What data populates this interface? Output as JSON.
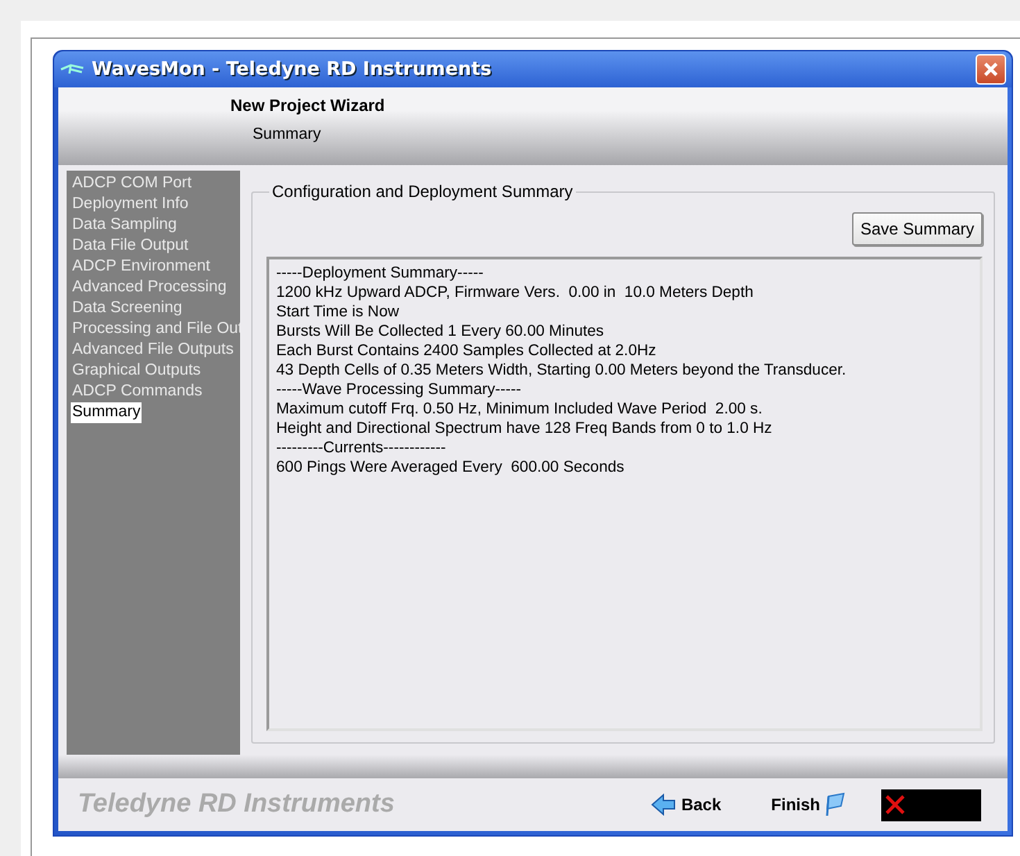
{
  "window": {
    "title": "WavesMon - Teledyne RD Instruments"
  },
  "header": {
    "title": "New Project Wizard",
    "subtitle": "Summary"
  },
  "sidebar": {
    "items": [
      {
        "label": "ADCP COM Port",
        "selected": false
      },
      {
        "label": "Deployment Info",
        "selected": false
      },
      {
        "label": "Data Sampling",
        "selected": false
      },
      {
        "label": "Data File Output",
        "selected": false
      },
      {
        "label": "ADCP Environment",
        "selected": false
      },
      {
        "label": "Advanced Processing",
        "selected": false
      },
      {
        "label": "Data Screening",
        "selected": false
      },
      {
        "label": "Processing and File Out",
        "selected": false
      },
      {
        "label": "Advanced File Outputs",
        "selected": false
      },
      {
        "label": "Graphical Outputs",
        "selected": false
      },
      {
        "label": "ADCP Commands",
        "selected": false
      },
      {
        "label": "Summary",
        "selected": true
      }
    ]
  },
  "group": {
    "title": "Configuration and Deployment Summary",
    "save_button": "Save Summary",
    "lines": [
      "-----Deployment Summary-----",
      "1200 kHz Upward ADCP, Firmware Vers.  0.00 in  10.0 Meters Depth",
      "Start Time is Now",
      "Bursts Will Be Collected 1 Every 60.00 Minutes",
      "Each Burst Contains 2400 Samples Collected at 2.0Hz",
      "43 Depth Cells of 0.35 Meters Width, Starting 0.00 Meters beyond the Transducer.",
      "-----Wave Processing Summary-----",
      "Maximum cutoff Frq. 0.50 Hz, Minimum Included Wave Period  2.00 s.",
      "Height and Directional Spectrum have 128 Freq Bands from 0 to 1.0 Hz",
      "---------Currents------------",
      "600 Pings Were Averaged Every  600.00 Seconds"
    ]
  },
  "footer": {
    "brand": "Teledyne RD Instruments",
    "back_button": "Back",
    "finish_button": "Finish"
  }
}
